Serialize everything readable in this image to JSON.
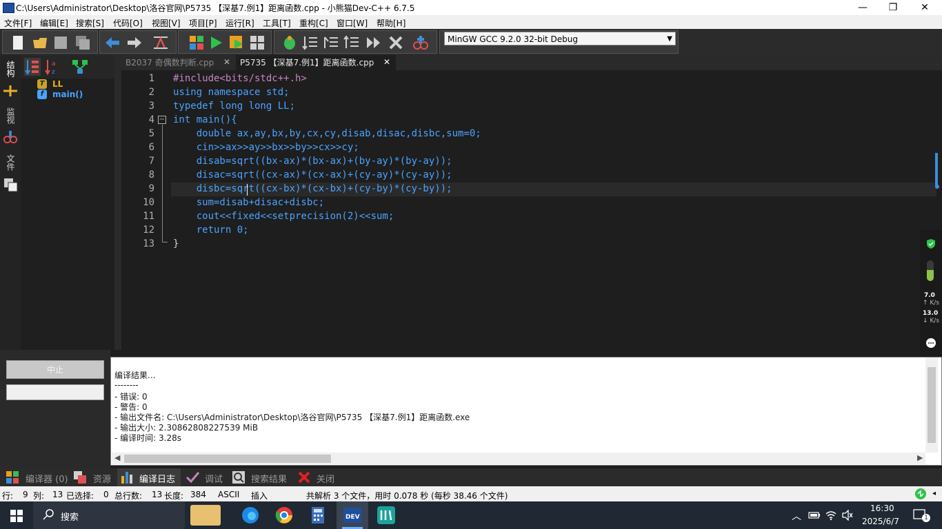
{
  "window": {
    "title": "C:\\Users\\Administrator\\Desktop\\洛谷官网\\P5735 【深基7.例1】距离函数.cpp - 小熊猫Dev-C++ 6.7.5",
    "minimize": "—",
    "maximize": "❐",
    "close": "✕"
  },
  "menu": [
    "文件[F]",
    "编辑[E]",
    "搜索[S]",
    "代码[O]",
    "视图[V]",
    "项目[P]",
    "运行[R]",
    "工具[T]",
    "重构[C]",
    "窗口[W]",
    "帮助[H]"
  ],
  "toolbar": {
    "compiler": "MinGW GCC 9.2.0 32-bit Debug"
  },
  "sidebar": {
    "tabs": [
      "结构",
      "监视",
      "文件"
    ],
    "tree": [
      {
        "icon_letter": "T",
        "label": "LL",
        "icon_color": "#c9a227"
      },
      {
        "icon_letter": "f",
        "label": "main()",
        "icon_color": "#4aa3ff"
      }
    ]
  },
  "editor_tabs": [
    {
      "label": "B2037 奇偶数判断.cpp",
      "active": false,
      "close": "✕"
    },
    {
      "label": "P5735 【深基7.例1】距离函数.cpp",
      "active": true,
      "close": "✕"
    }
  ],
  "code_lines": [
    "#include<bits/stdc++.h>",
    "using namespace std;",
    "typedef long long LL;",
    "int main(){",
    "    double ax,ay,bx,by,cx,cy,disab,disac,disbc,sum=0;",
    "    cin>>ax>>ay>>bx>>by>>cx>>cy;",
    "    disab=sqrt((bx-ax)*(bx-ax)+(by-ay)*(by-ay));",
    "    disac=sqrt((cx-ax)*(cx-ax)+(cy-ay)*(cy-ay));",
    "    disbc=sqrt((cx-bx)*(cx-bx)+(cy-by)*(cy-by));",
    "    sum=disab+disac+disbc;",
    "    cout<<fixed<<setprecision(2)<<sum;",
    "    return 0;",
    "}"
  ],
  "line_numbers": [
    "1",
    "2",
    "3",
    "4",
    "5",
    "6",
    "7",
    "8",
    "9",
    "10",
    "11",
    "12",
    "13"
  ],
  "fold_marker": "−",
  "widget": {
    "up_speed": "7.0",
    "up_unit": "↑ K/s",
    "down_speed": "13.0",
    "down_unit": "↓ K/s"
  },
  "bottom": {
    "stop_label": "中止",
    "log": [
      "编译结果...",
      "--------",
      "- 错误: 0",
      "- 警告: 0",
      "- 输出文件名: C:\\Users\\Administrator\\Desktop\\洛谷官网\\P5735 【深基7.例1】距离函数.exe",
      "- 输出大小: 2.30862808227539 MiB",
      "- 编译时间: 3.28s"
    ],
    "tabs": [
      "编译器 (0)",
      "资源",
      "编译日志",
      "调试",
      "搜索结果",
      "关闭"
    ]
  },
  "status": {
    "row_label": "行:",
    "row": "9",
    "col_label": "列:",
    "col": "13",
    "sel_label": "已选择:",
    "sel": "0",
    "lines_label": "总行数:",
    "lines": "13",
    "len_label": "长度:",
    "len": "384",
    "encoding": "ASCII",
    "mode": "插入",
    "parse_info": "共解析 3 个文件，用时 0.078 秒 (每秒 38.46 个文件)"
  },
  "taskbar": {
    "search": "搜索",
    "time": "16:30",
    "date": "2025/6/7",
    "notif_count": "1",
    "tray_chevron": "︿"
  },
  "colors": {
    "keyword": "#4aa3ff",
    "preprocessor": "#c586c0",
    "number": "#e0e0e0",
    "text": "#d4d4d4"
  }
}
